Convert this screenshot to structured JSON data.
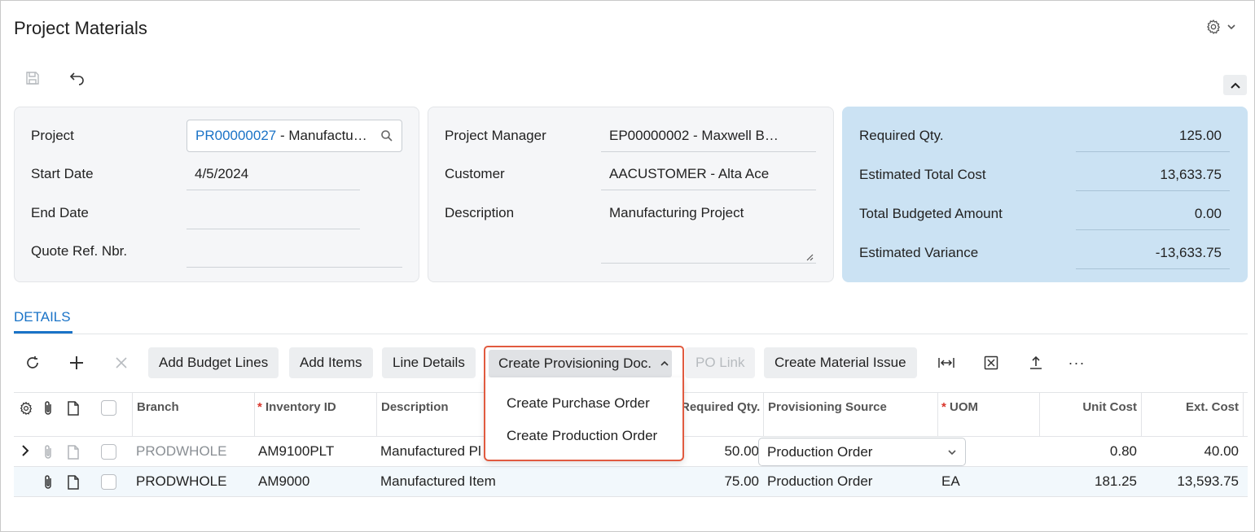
{
  "page": {
    "title": "Project Materials"
  },
  "summary": {
    "project_label": "Project",
    "project_code": "PR00000027",
    "project_name": " - Manufactu…",
    "start_date_label": "Start Date",
    "start_date": "4/5/2024",
    "end_date_label": "End Date",
    "end_date": "",
    "quote_ref_label": "Quote Ref. Nbr.",
    "quote_ref": "",
    "manager_label": "Project Manager",
    "manager": "EP00000002 - Maxwell B…",
    "customer_label": "Customer",
    "customer": "AACUSTOMER - Alta Ace",
    "description_label": "Description",
    "description": "Manufacturing Project"
  },
  "totals": {
    "required_qty_label": "Required Qty.",
    "required_qty": "125.00",
    "est_total_cost_label": "Estimated Total Cost",
    "est_total_cost": "13,633.75",
    "total_budgeted_label": "Total Budgeted Amount",
    "total_budgeted": "0.00",
    "est_variance_label": "Estimated Variance",
    "est_variance": "-13,633.75"
  },
  "tabs": {
    "details": "DETAILS"
  },
  "toolbar": {
    "add_budget_lines": "Add Budget Lines",
    "add_items": "Add Items",
    "line_details": "Line Details",
    "create_provisioning": "Create Provisioning Doc.",
    "po_link": "PO Link",
    "create_material_issue": "Create Material Issue",
    "more": "···"
  },
  "dropdown": {
    "items": [
      "Create Purchase Order",
      "Create Production Order"
    ]
  },
  "grid": {
    "headers": {
      "branch": "Branch",
      "inventory_id": "Inventory ID",
      "description": "Description",
      "required_qty": "Required Qty.",
      "provisioning_source": "Provisioning Source",
      "uom": "UOM",
      "unit_cost": "Unit Cost",
      "ext_cost": "Ext. Cost"
    },
    "rows": [
      {
        "branch": "PRODWHOLE",
        "inventory_id": "AM9100PLT",
        "description": "Manufactured Pl",
        "required_qty": "50.00",
        "provisioning_source": "Production Order",
        "uom": "",
        "unit_cost": "0.80",
        "ext_cost": "40.00"
      },
      {
        "branch": "PRODWHOLE",
        "inventory_id": "AM9000",
        "description": "Manufactured Item",
        "required_qty": "75.00",
        "provisioning_source": "Production Order",
        "uom": "EA",
        "unit_cost": "181.25",
        "ext_cost": "13,593.75"
      }
    ]
  },
  "colors": {
    "accent": "#1a73c7",
    "highlight_border": "#e15a3f",
    "totals_panel": "#cbe2f3"
  }
}
